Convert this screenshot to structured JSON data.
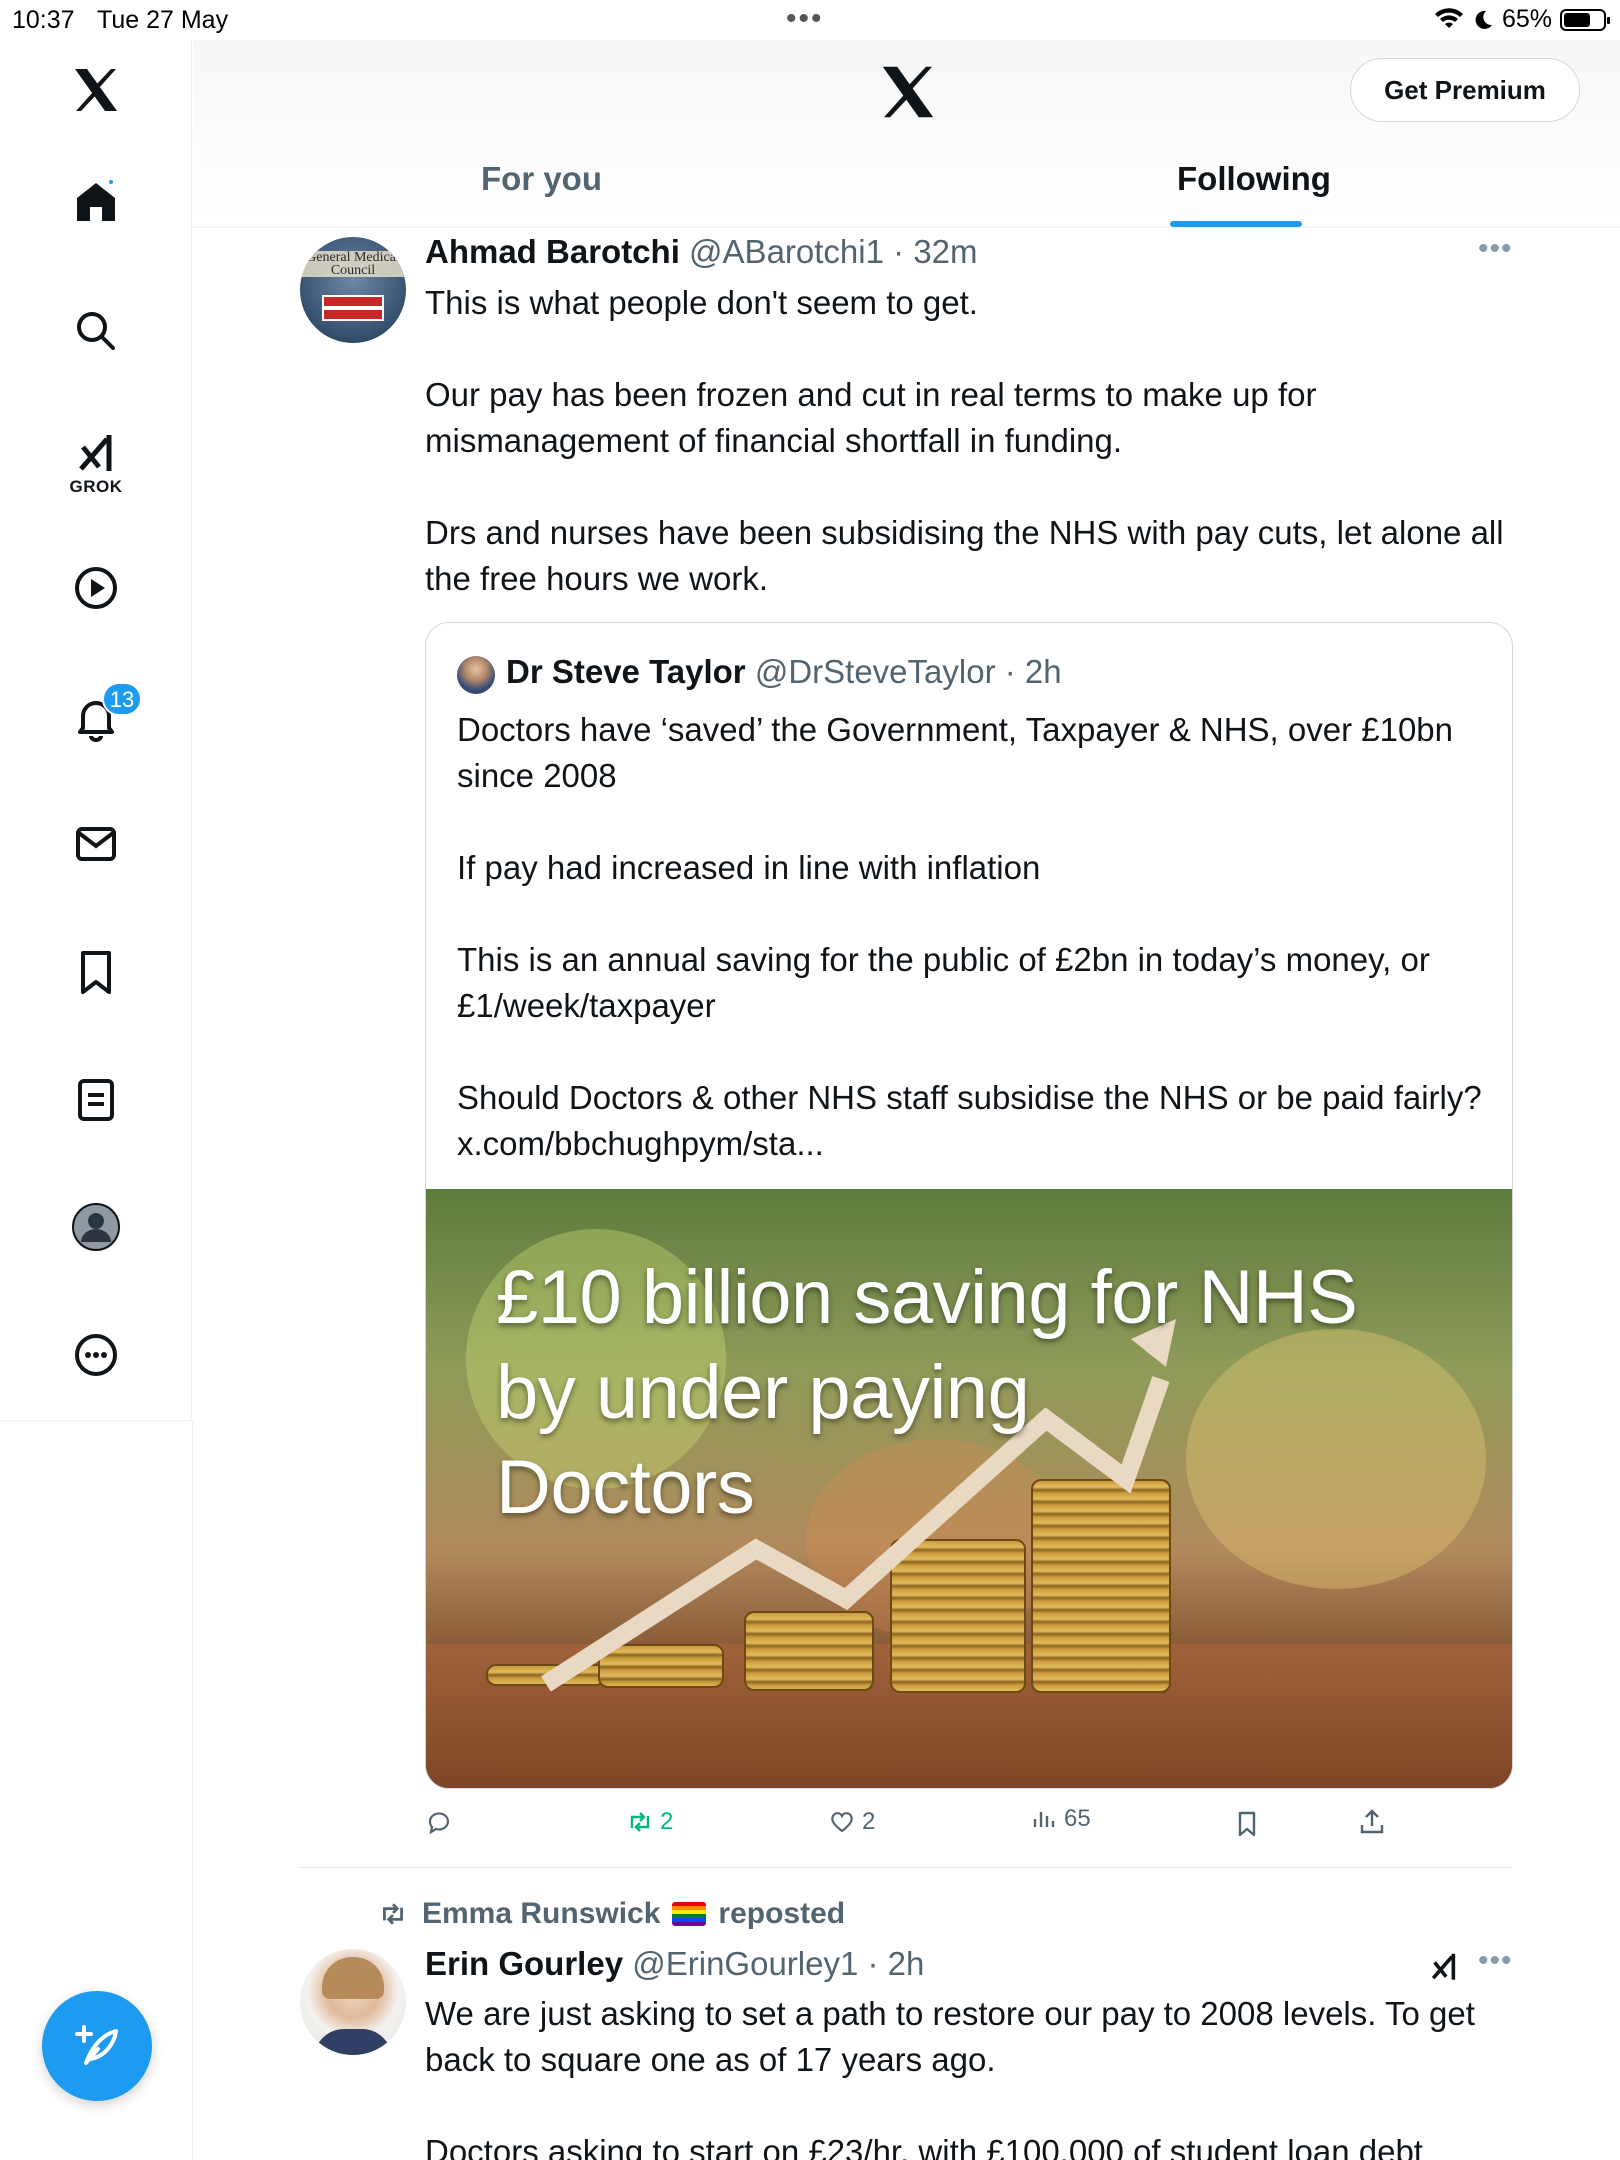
{
  "status_bar": {
    "time": "10:37",
    "date": "Tue 27 May",
    "battery_percent": "65%",
    "battery_level": 0.65
  },
  "sidebar": {
    "items": [
      {
        "name": "home",
        "icon": "home-icon"
      },
      {
        "name": "explore",
        "icon": "search-icon"
      },
      {
        "name": "grok",
        "icon": "grok-icon",
        "label": "GROK"
      },
      {
        "name": "videos",
        "icon": "play-icon"
      },
      {
        "name": "notifications",
        "icon": "bell-icon",
        "badge": "13"
      },
      {
        "name": "messages",
        "icon": "mail-icon"
      },
      {
        "name": "bookmarks",
        "icon": "bookmark-icon"
      },
      {
        "name": "lists",
        "icon": "list-icon"
      },
      {
        "name": "profile",
        "icon": "profile-avatar"
      },
      {
        "name": "more",
        "icon": "more-circle-icon"
      }
    ]
  },
  "header": {
    "premium_label": "Get Premium",
    "tabs": [
      {
        "label": "For you",
        "active": false
      },
      {
        "label": "Following",
        "active": true
      }
    ]
  },
  "tweets": [
    {
      "name": "Ahmad Barotchi",
      "handle": "@ABarotchi1",
      "time": "32m",
      "avatar_text": "General Medical Council",
      "paragraphs": [
        "This is what people don't seem to get.",
        "Our pay has been frozen and cut in real terms to make up for mismanagement of financial shortfall in funding.",
        "Drs and nurses have been subsidising the NHS with pay cuts, let alone all the free hours we work."
      ],
      "quote": {
        "name": "Dr Steve Taylor",
        "handle": "@DrSteveTaylor",
        "time": "2h",
        "paragraphs": [
          "Doctors have ‘saved’ the Government, Taxpayer & NHS, over £10bn since 2008",
          "If pay had increased in line with inflation",
          "This is an annual saving for the public of £2bn in today’s money, or £1/week/taxpayer",
          "Should Doctors & other NHS staff subsidise the NHS or be paid fairly? x.com/bbchughpym/sta..."
        ],
        "image_lines": [
          "£10 billion saving for NHS",
          "by under paying",
          "Doctors"
        ]
      },
      "actions": {
        "replies": "",
        "reposts": "2",
        "likes": "2",
        "views": "65"
      }
    },
    {
      "repost_by": "Emma Runswick",
      "repost_suffix": "reposted",
      "name": "Erin Gourley",
      "handle": "@ErinGourley1",
      "time": "2h",
      "paragraphs": [
        "We are just asking to set a path to restore our pay to 2008 levels. To get back to square one as of 17 years ago.",
        "Doctors asking to start on £23/hr, with £100,000 of student loan debt"
      ]
    }
  ],
  "colors": {
    "accent": "#1d9bf0",
    "repost_green": "#00ba7c",
    "secondary_text": "#536471"
  }
}
